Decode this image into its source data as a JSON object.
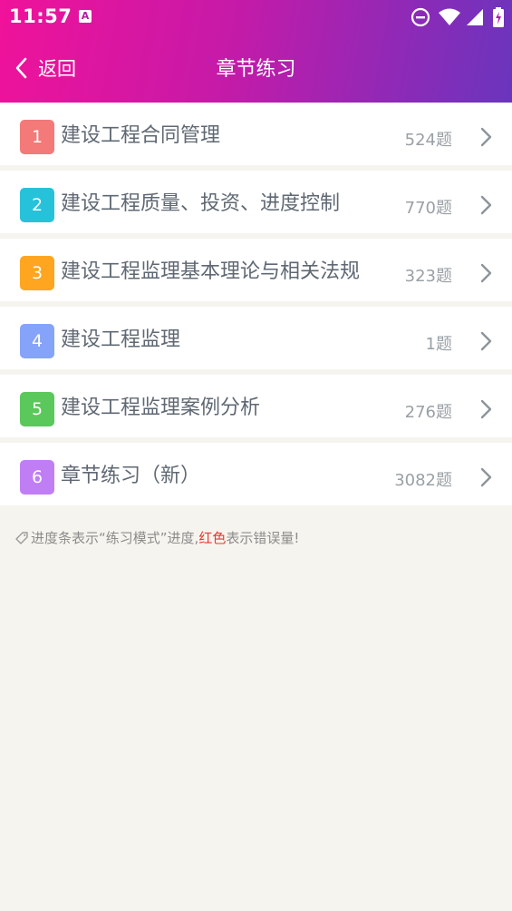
{
  "status_bar": {
    "time": "11:57",
    "icons": [
      "a-notification-icon",
      "dnd-icon",
      "wifi-icon",
      "signal-icon",
      "battery-icon"
    ]
  },
  "nav": {
    "back_label": "返回",
    "title": "章节练习"
  },
  "chapters": [
    {
      "index": "1",
      "title": "建设工程合同管理",
      "count": "524题",
      "color": "#f47979"
    },
    {
      "index": "2",
      "title": "建设工程质量、投资、进度控制",
      "count": "770题",
      "color": "#26c2d9"
    },
    {
      "index": "3",
      "title": "建设工程监理基本理论与相关法规",
      "count": "323题",
      "color": "#ffa51f"
    },
    {
      "index": "4",
      "title": "建设工程监理",
      "count": "1题",
      "color": "#86a3fa"
    },
    {
      "index": "5",
      "title": "建设工程监理案例分析",
      "count": "276题",
      "color": "#5ac85a"
    },
    {
      "index": "6",
      "title": "章节练习（新）",
      "count": "3082题",
      "color": "#c07ef5"
    }
  ],
  "tip": {
    "part1": "进度条表示“练习模式”进度,",
    "red": "红色",
    "part2": "表示错误量!"
  },
  "colors": {
    "header_gradient_start": "#f0129a",
    "header_gradient_end": "#6a35bd",
    "background": "#f6f4ee",
    "tip_red": "#e53935"
  }
}
